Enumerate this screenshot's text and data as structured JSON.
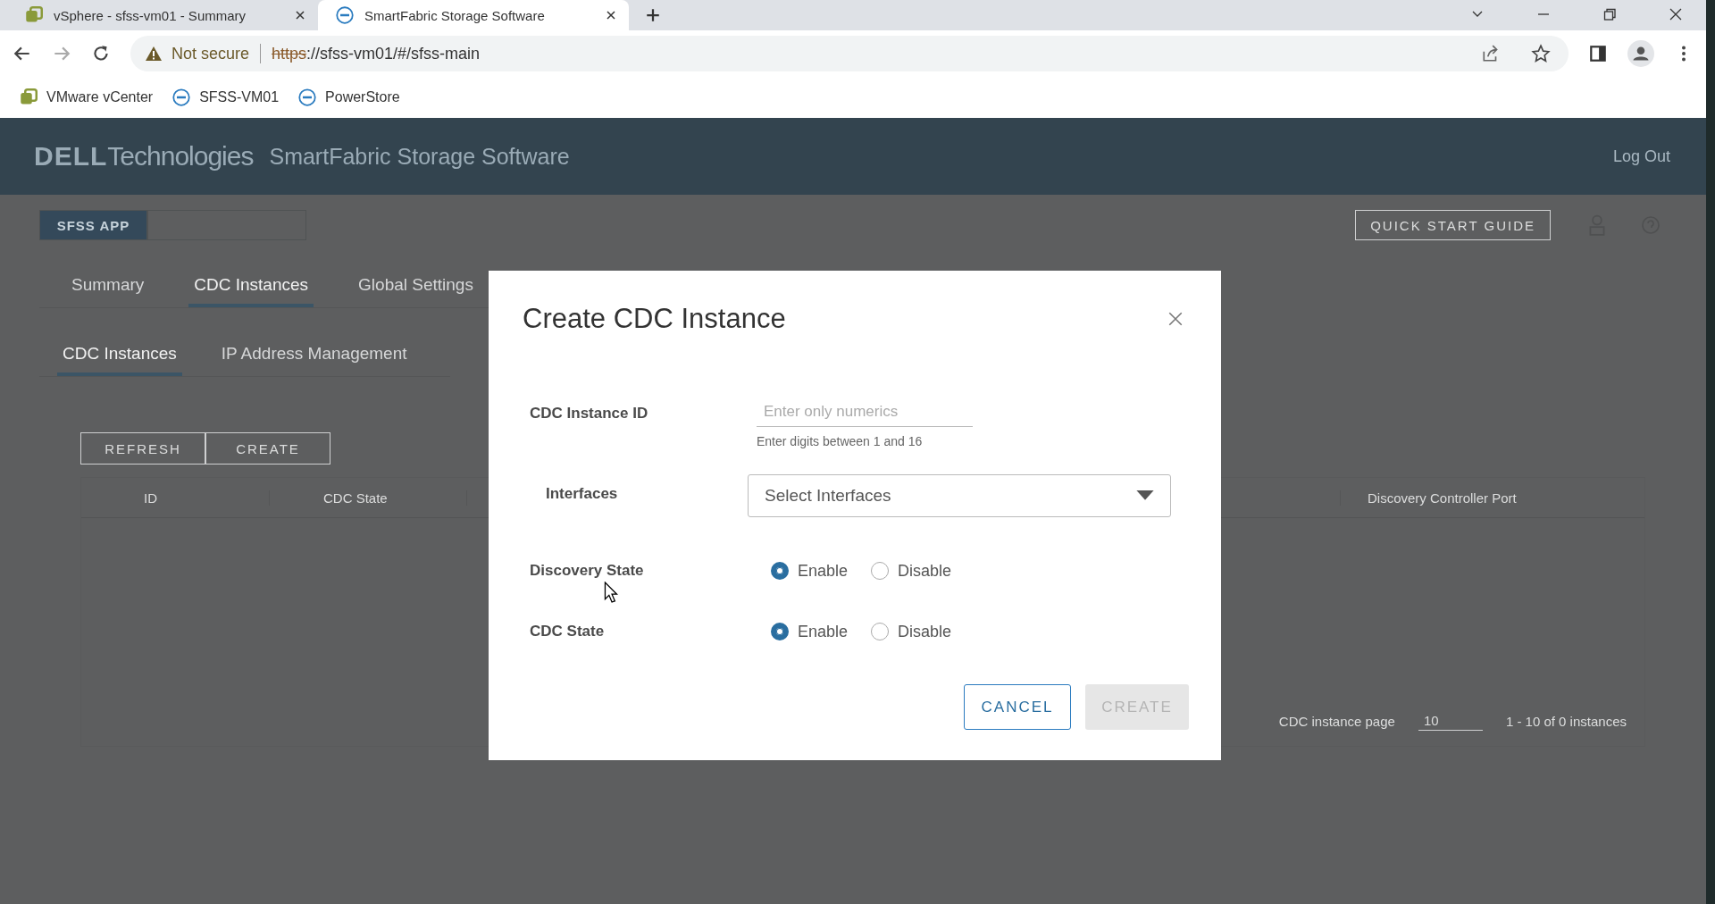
{
  "browser": {
    "tabs": [
      {
        "title": "vSphere - sfss-vm01 - Summary",
        "selected": false
      },
      {
        "title": "SmartFabric Storage Software",
        "selected": true
      }
    ],
    "address": {
      "warning": "Not secure",
      "scheme": "https",
      "rest": "://sfss-vm01/#/sfss-main"
    },
    "bookmarks": [
      {
        "label": "VMware vCenter"
      },
      {
        "label": "SFSS-VM01"
      },
      {
        "label": "PowerStore"
      }
    ]
  },
  "app": {
    "logo": "DELL",
    "logo_suffix": "Technologies",
    "product": "SmartFabric Storage Software",
    "logout": "Log Out",
    "switch": [
      {
        "label": "SFSS APP",
        "selected": true
      },
      {
        "selected": false
      }
    ],
    "quick_start": "QUICK START GUIDE",
    "tabs": [
      {
        "label": "Summary",
        "selected": false
      },
      {
        "label": "CDC Instances",
        "selected": true
      },
      {
        "label": "Global Settings",
        "selected": false
      }
    ],
    "subtabs": [
      {
        "label": "CDC Instances",
        "selected": true
      },
      {
        "label": "IP Address Management",
        "selected": false
      }
    ],
    "toolbar": [
      "REFRESH",
      "CREATE"
    ],
    "columns": [
      "ID",
      "CDC State",
      "Discovery Controller Port"
    ],
    "footer": {
      "per_page_label": "CDC instance page",
      "per_page": "10",
      "range": "1 - 10 of 0 instances"
    }
  },
  "dialog": {
    "title": "Create CDC Instance",
    "fields": [
      {
        "kind": "text",
        "label": "CDC Instance ID",
        "placeholder": "Enter only numerics",
        "hint": "Enter digits between 1 and 16"
      },
      {
        "kind": "select",
        "label": "Interfaces",
        "placeholder": "Select Interfaces"
      },
      {
        "kind": "radio",
        "label": "Discovery State",
        "options": [
          {
            "label": "Enable",
            "selected": true
          },
          {
            "label": "Disable",
            "selected": false
          }
        ]
      },
      {
        "kind": "radio",
        "label": "CDC State",
        "options": [
          {
            "label": "Enable",
            "selected": true
          },
          {
            "label": "Disable",
            "selected": false
          }
        ]
      }
    ],
    "buttons": [
      {
        "label": "CANCEL",
        "kind": "secondary",
        "disabled": false
      },
      {
        "label": "CREATE",
        "kind": "primary",
        "disabled": true
      }
    ]
  }
}
